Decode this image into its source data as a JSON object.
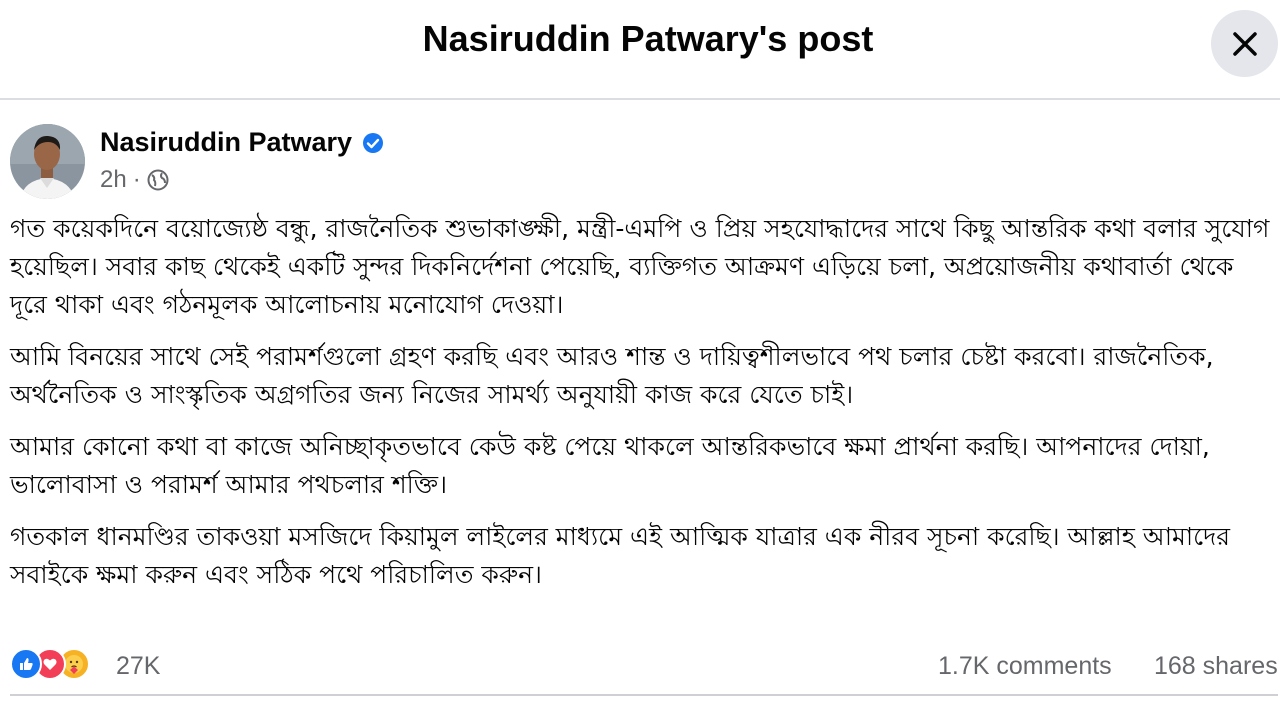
{
  "header": {
    "title": "Nasiruddin Patwary's post"
  },
  "author": {
    "name": "Nasiruddin Patwary",
    "time": "2h",
    "privacy_icon": "globe-icon",
    "verified": true
  },
  "post": {
    "paragraphs": [
      "গত কয়েকদিনে বয়োজ্যেষ্ঠ বন্ধু, রাজনৈতিক শুভাকাঙ্ক্ষী, মন্ত্রী-এমপি ও প্রিয় সহযোদ্ধাদের সাথে কিছু আন্তরিক কথা বলার সুযোগ হয়েছিল। সবার কাছ থেকেই একটি সুন্দর দিকনির্দেশনা পেয়েছি, ব্যক্তিগত আক্রমণ এড়িয়ে চলা, অপ্রয়োজনীয় কথাবার্তা থেকে দূরে থাকা এবং গঠনমূলক আলোচনায় মনোযোগ দেওয়া।",
      "আমি বিনয়ের সাথে সেই পরামর্শগুলো গ্রহণ করছি এবং আরও শান্ত ও দায়িত্বশীলভাবে পথ চলার চেষ্টা করবো। রাজনৈতিক, অর্থনৈতিক ও সাংস্কৃতিক অগ্রগতির জন্য নিজের সামর্থ্য অনুযায়ী কাজ করে যেতে চাই।",
      "আমার কোনো কথা বা কাজে অনিচ্ছাকৃতভাবে কেউ কষ্ট পেয়ে থাকলে আন্তরিকভাবে ক্ষমা প্রার্থনা করছি। আপনাদের দোয়া, ভালোবাসা ও পরামর্শ আমার পথচলার শক্তি।",
      "গতকাল ধানমণ্ডির তাকওয়া মসজিদে কিয়ামুল লাইলের মাধ্যমে এই আত্মিক যাত্রার এক নীরব সূচনা করেছি। আল্লাহ আমাদের সবাইকে ক্ষমা করুন এবং সঠিক পথে পরিচালিত করুন।"
    ]
  },
  "engagement": {
    "reaction_icons": [
      "like-icon",
      "love-icon",
      "care-icon"
    ],
    "reactions": "27K",
    "comments": "1.7K comments",
    "shares": "168 shares"
  },
  "colors": {
    "text": "#050505",
    "secondary": "#65676b",
    "verified": "#1877f2",
    "like": "#1877f2",
    "love": "#f33e58",
    "care": "#f7b125",
    "close_bg": "#e4e6eb"
  }
}
